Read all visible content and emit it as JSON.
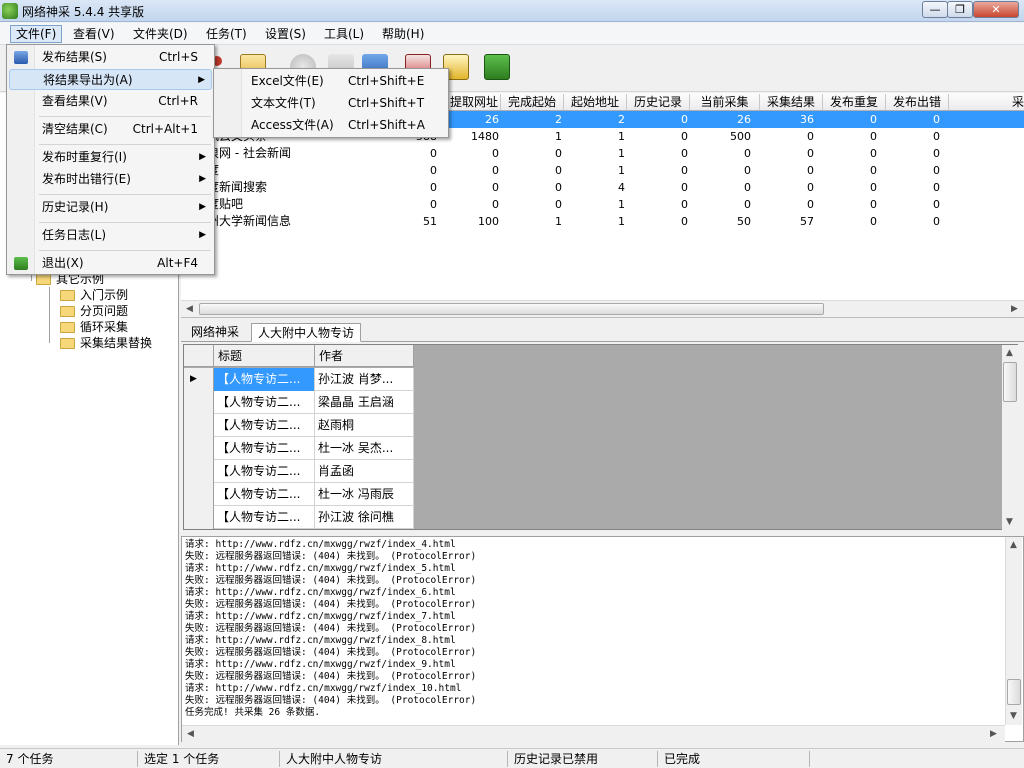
{
  "window": {
    "title": "网络神采 5.4.4 共享版"
  },
  "menubar": {
    "items": [
      "文件(F)",
      "查看(V)",
      "文件夹(D)",
      "任务(T)",
      "设置(S)",
      "工具(L)",
      "帮助(H)"
    ]
  },
  "file_menu": {
    "items": [
      {
        "label": "发布结果(S)",
        "shortcut": "Ctrl+S"
      },
      {
        "label": "将结果导出为(A)",
        "shortcut": ""
      },
      {
        "label": "查看结果(V)",
        "shortcut": "Ctrl+R"
      },
      {
        "label": "清空结果(C)",
        "shortcut": "Ctrl+Alt+1"
      },
      {
        "label": "发布时重复行(I)",
        "shortcut": ""
      },
      {
        "label": "发布时出错行(E)",
        "shortcut": ""
      },
      {
        "label": "历史记录(H)",
        "shortcut": ""
      },
      {
        "label": "任务日志(L)",
        "shortcut": ""
      },
      {
        "label": "退出(X)",
        "shortcut": "Alt+F4"
      }
    ]
  },
  "export_menu": {
    "items": [
      {
        "label": "Excel文件(E)",
        "shortcut": "Ctrl+Shift+E"
      },
      {
        "label": "文本文件(T)",
        "shortcut": "Ctrl+Shift+T"
      },
      {
        "label": "Access文件(A)",
        "shortcut": "Ctrl+Shift+A"
      }
    ]
  },
  "tree": {
    "group": "其它示例",
    "children": [
      "入门示例",
      "分页问题",
      "循环采集",
      "采集结果替换"
    ]
  },
  "task_grid": {
    "columns": [
      "提取网址",
      "完成起始",
      "起始地址",
      "历史记录",
      "当前采集",
      "采集结果",
      "发布重复",
      "发布出错",
      "采"
    ],
    "rows": [
      {
        "name": "",
        "c0": "",
        "c1": "26",
        "c2": "2",
        "c3": "2",
        "c4": "0",
        "c5": "26",
        "c6": "36",
        "c7": "0",
        "c8": "0"
      },
      {
        "name": "讯云文头条",
        "c0": "588",
        "c1": "1480",
        "c2": "1",
        "c3": "1",
        "c4": "0",
        "c5": "500",
        "c6": "0",
        "c7": "0",
        "c8": "0"
      },
      {
        "name": "浪网 - 社会新闻",
        "c0": "0",
        "c1": "0",
        "c2": "0",
        "c3": "1",
        "c4": "0",
        "c5": "0",
        "c6": "0",
        "c7": "0",
        "c8": "0"
      },
      {
        "name": "度",
        "c0": "0",
        "c1": "0",
        "c2": "0",
        "c3": "1",
        "c4": "0",
        "c5": "0",
        "c6": "0",
        "c7": "0",
        "c8": "0"
      },
      {
        "name": "度新闻搜索",
        "c0": "0",
        "c1": "0",
        "c2": "0",
        "c3": "4",
        "c4": "0",
        "c5": "0",
        "c6": "0",
        "c7": "0",
        "c8": "0"
      },
      {
        "name": "度贴吧",
        "c0": "0",
        "c1": "0",
        "c2": "0",
        "c3": "1",
        "c4": "0",
        "c5": "0",
        "c6": "0",
        "c7": "0",
        "c8": "0"
      },
      {
        "name": "州大学新闻信息",
        "c0": "51",
        "c1": "100",
        "c2": "1",
        "c3": "1",
        "c4": "0",
        "c5": "50",
        "c6": "57",
        "c7": "0",
        "c8": "0"
      }
    ]
  },
  "tabs": [
    "网络神采",
    "人大附中人物专访"
  ],
  "results": {
    "columns": [
      "标题",
      "作者"
    ],
    "rows": [
      [
        "【人物专访二...",
        "孙江波  肖梦..."
      ],
      [
        "【人物专访二...",
        "梁晶晶 王启涵"
      ],
      [
        "【人物专访二...",
        "赵雨桐"
      ],
      [
        "【人物专访二...",
        "杜一冰 吴杰..."
      ],
      [
        "【人物专访二...",
        "肖孟函"
      ],
      [
        "【人物专访二...",
        "杜一冰  冯雨辰"
      ],
      [
        "【人物专访二...",
        "孙江波 徐问樵"
      ]
    ]
  },
  "log": [
    "请求: http://www.rdfz.cn/mxwgg/rwzf/index_4.html",
    "失败: 远程服务器返回错误: (404) 未找到。 (ProtocolError)",
    "请求: http://www.rdfz.cn/mxwgg/rwzf/index_5.html",
    "失败: 远程服务器返回错误: (404) 未找到。 (ProtocolError)",
    "请求: http://www.rdfz.cn/mxwgg/rwzf/index_6.html",
    "失败: 远程服务器返回错误: (404) 未找到。 (ProtocolError)",
    "请求: http://www.rdfz.cn/mxwgg/rwzf/index_7.html",
    "失败: 远程服务器返回错误: (404) 未找到。 (ProtocolError)",
    "请求: http://www.rdfz.cn/mxwgg/rwzf/index_8.html",
    "失败: 远程服务器返回错误: (404) 未找到。 (ProtocolError)",
    "请求: http://www.rdfz.cn/mxwgg/rwzf/index_9.html",
    "失败: 远程服务器返回错误: (404) 未找到。 (ProtocolError)",
    "请求: http://www.rdfz.cn/mxwgg/rwzf/index_10.html",
    "失败: 远程服务器返回错误: (404) 未找到。 (ProtocolError)",
    "任务完成! 共采集 26 条数据."
  ],
  "statusbar": [
    "7 个任务",
    "选定 1 个任务",
    "人大附中人物专访",
    "历史记录已禁用",
    "已完成"
  ],
  "colors": {
    "selection": "#3399ff",
    "menu_highlight": "#d7e6f7"
  }
}
